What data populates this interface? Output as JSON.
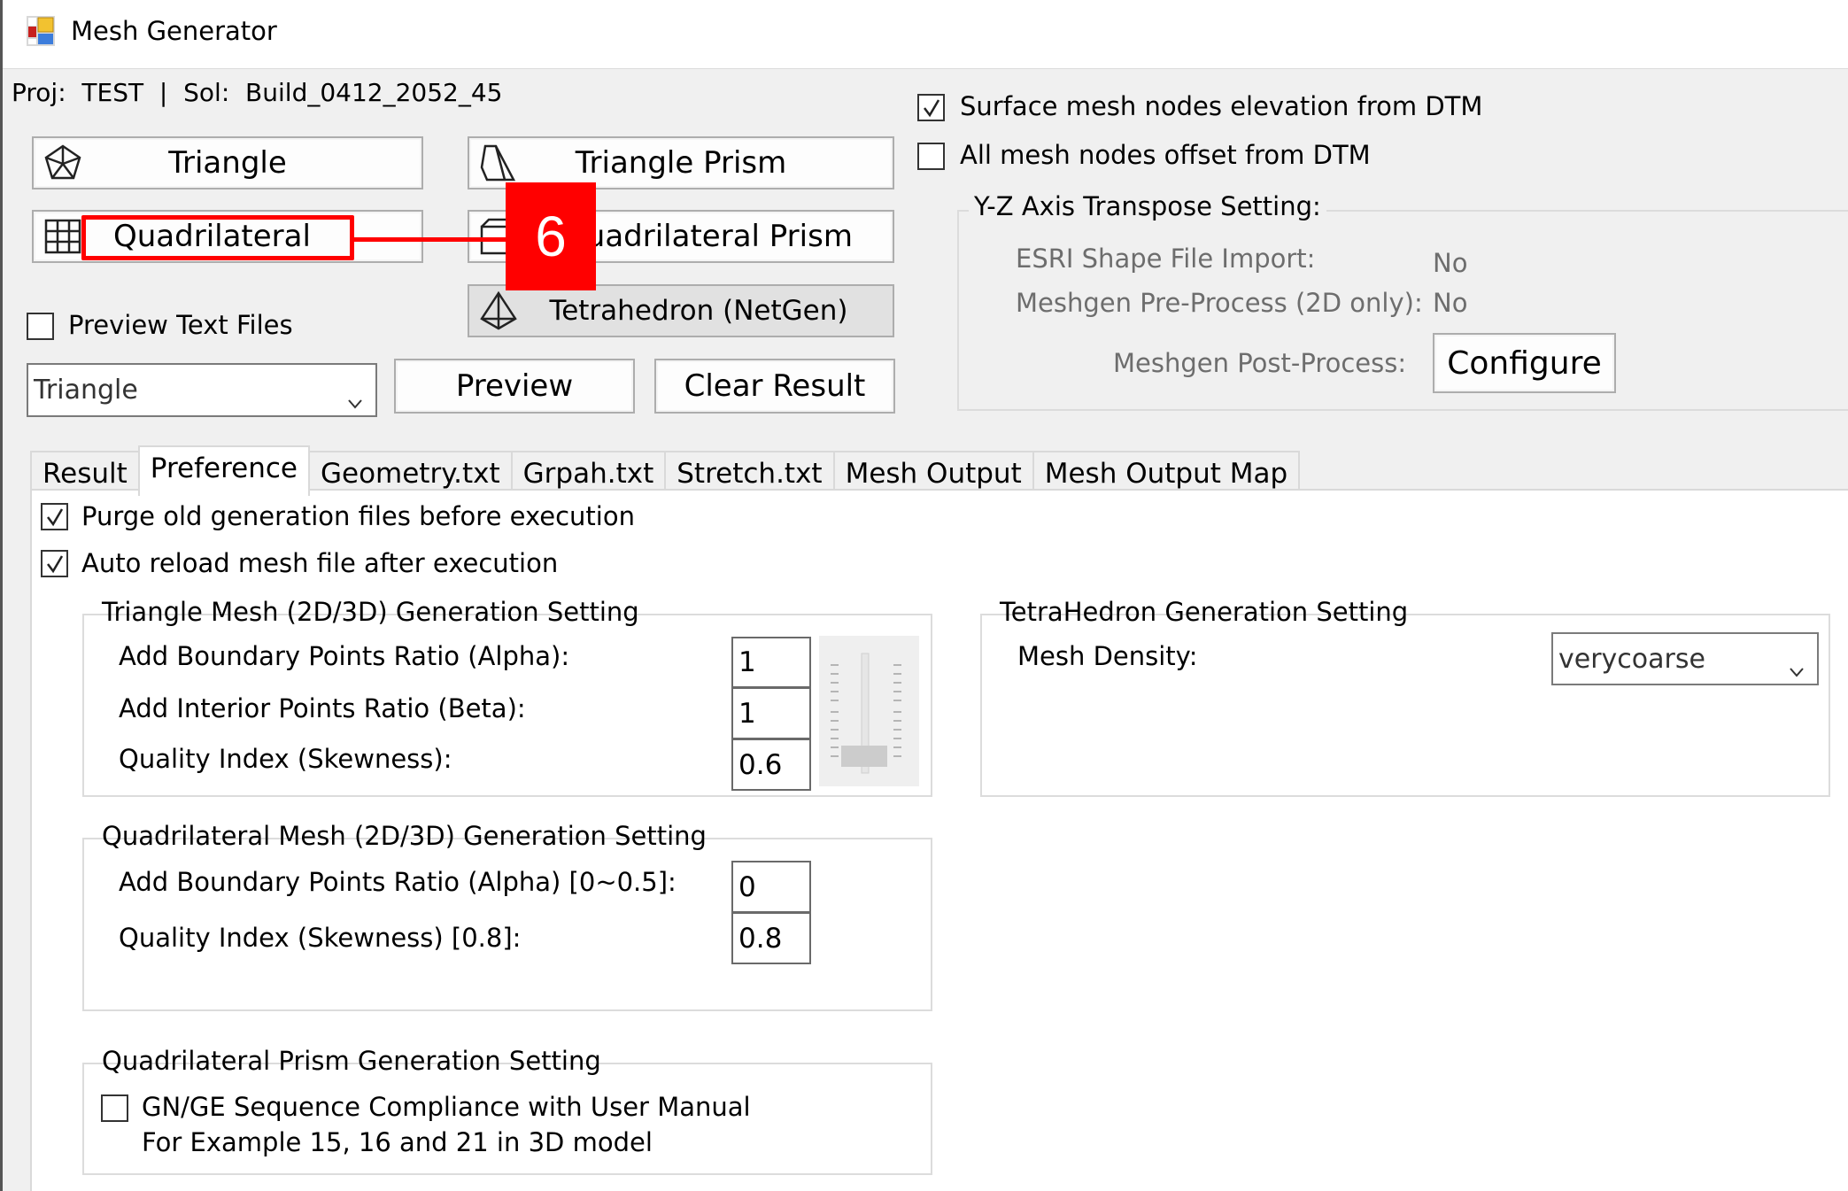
{
  "window": {
    "title": "Mesh Generator",
    "icon": "app-icon"
  },
  "header": {
    "project_line": "Proj:  TEST  |  Sol:  Build_0412_2052_45"
  },
  "mesh_buttons": {
    "triangle": {
      "label": "Triangle",
      "icon": "pentagon-mesh-icon"
    },
    "triangle_prism": {
      "label": "Triangle Prism",
      "icon": "triangle-prism-icon"
    },
    "quadrilateral": {
      "label": "Quadrilateral",
      "icon": "grid-icon"
    },
    "quadrilateral_prism": {
      "label": "Quadrilateral  Prism",
      "icon": "box-prism-icon"
    },
    "tetrahedron": {
      "label": "Tetrahedron (NetGen)",
      "icon": "tetrahedron-icon"
    }
  },
  "preview": {
    "preview_text_files_label": "Preview Text Files",
    "preview_text_files_checked": false,
    "type_combo_value": "Triangle",
    "preview_button": "Preview",
    "clear_result_button": "Clear Result"
  },
  "dtm_options": {
    "surface_elevation_label": "Surface mesh nodes elevation from DTM",
    "surface_elevation_checked": true,
    "offset_label": "All mesh nodes offset from DTM",
    "offset_checked": false
  },
  "yz_group": {
    "title": "Y-Z Axis Transpose Setting:",
    "esri_label": "ESRI Shape File Import:",
    "esri_value": "No",
    "pre_process_label": "Meshgen Pre-Process (2D only):",
    "pre_process_value": "No",
    "post_process_label": "Meshgen Post-Process:",
    "configure_button": "Configure"
  },
  "tabs": [
    {
      "label": "Result",
      "active": false
    },
    {
      "label": "Preference",
      "active": true
    },
    {
      "label": "Geometry.txt",
      "active": false
    },
    {
      "label": "Grpah.txt",
      "active": false
    },
    {
      "label": "Stretch.txt",
      "active": false
    },
    {
      "label": "Mesh Output",
      "active": false
    },
    {
      "label": "Mesh Output Map",
      "active": false
    }
  ],
  "preference": {
    "purge_label": "Purge old generation files before execution",
    "purge_checked": true,
    "auto_reload_label": "Auto reload mesh file after execution",
    "auto_reload_checked": true,
    "triangle_group": {
      "title": "Triangle Mesh (2D/3D) Generation Setting",
      "alpha_label": "Add Boundary Points Ratio (Alpha):",
      "alpha_value": "1",
      "beta_label": "Add Interior Points Ratio (Beta):",
      "beta_value": "1",
      "quality_label": "Quality Index (Skewness):",
      "quality_value": "0.6",
      "slider_level": 0.1
    },
    "tetra_group": {
      "title": "TetraHedron Generation Setting",
      "density_label": "Mesh Density:",
      "density_value": "verycoarse"
    },
    "quad_group": {
      "title": "Quadrilateral Mesh (2D/3D) Generation Setting",
      "alpha_label": "Add Boundary Points Ratio (Alpha) [0~0.5]:",
      "alpha_value": "0",
      "quality_label": "Quality Index (Skewness) [0.8]:",
      "quality_value": "0.8"
    },
    "quad_prism_group": {
      "title": "Quadrilateral Prism Generation Setting",
      "gnge_label": "GN/GE Sequence Compliance with User Manual",
      "gnge_checked": false,
      "note": "For Example 15, 16 and 21 in 3D model"
    }
  },
  "annotation": {
    "step_number": "6",
    "color": "#ff0000"
  }
}
